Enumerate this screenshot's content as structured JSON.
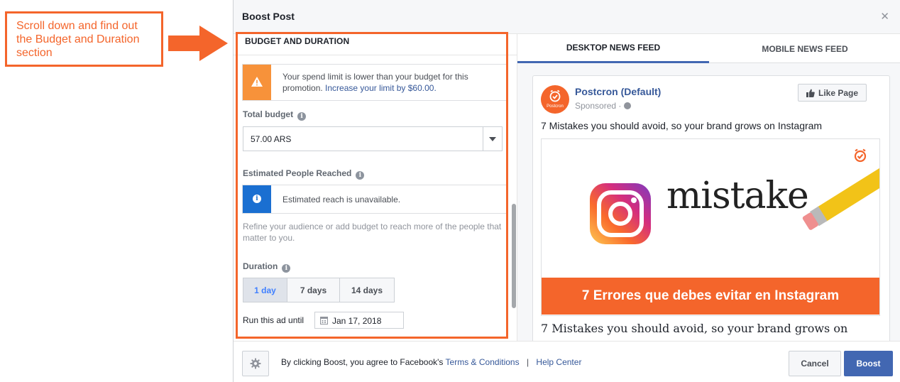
{
  "annotation": {
    "text": "Scroll down and find out the Budget and Duration section",
    "color": "#f4652b"
  },
  "dialog": {
    "title": "Boost Post",
    "close_icon": "close-icon"
  },
  "budget_section": {
    "title": "BUDGET AND DURATION",
    "warning": {
      "icon": "warning-icon",
      "text": "Your spend limit is lower than your budget for this promotion.",
      "link": "Increase your limit by $60.00."
    },
    "total_budget_label": "Total budget",
    "total_budget_value": "57.00 ARS",
    "reach_label": "Estimated People Reached",
    "reach_info": "Estimated reach is unavailable.",
    "refine_text": "Refine your audience or add budget to reach more of the people that matter to you.",
    "duration_label": "Duration",
    "duration_options": [
      "1 day",
      "7 days",
      "14 days"
    ],
    "duration_selected": "1 day",
    "run_until_label": "Run this ad until",
    "run_until_date": "Jan 17, 2018"
  },
  "preview": {
    "tabs": [
      "DESKTOP NEWS FEED",
      "MOBILE NEWS FEED"
    ],
    "active_tab": "DESKTOP NEWS FEED",
    "page_name": "Postcron (Default)",
    "avatar_text": "Postcron",
    "sponsored": "Sponsored · ",
    "like_label": "Like Page",
    "post_text": "7 Mistakes you should avoid, so your brand grows on Instagram",
    "image_word": "mistake",
    "banner_text": "7 Errores que debes evitar en Instagram",
    "headline": "7 Mistakes you should avoid, so your brand grows on"
  },
  "footer": {
    "agree_text": "By clicking Boost, you agree to Facebook's",
    "terms_link": "Terms & Conditions",
    "separator": "|",
    "help_link": "Help Center",
    "cancel_label": "Cancel",
    "boost_label": "Boost"
  },
  "colors": {
    "accent": "#4267b2",
    "link": "#365899",
    "warning": "#f7923a",
    "info": "#1a6fd1",
    "highlight": "#f4652b"
  }
}
